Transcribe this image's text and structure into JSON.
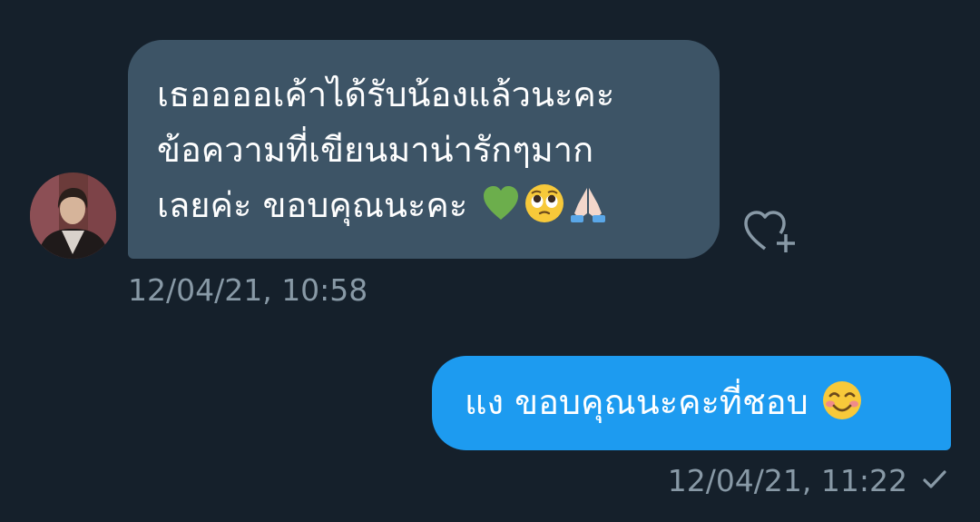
{
  "conversation": {
    "incoming": {
      "lines": [
        "เธออออเค้าได้รับน้องแล้วนะคะ",
        "ข้อความที่เขียนมาน่ารักๆมาก",
        "เลยค่ะ ขอบคุณนะคะ"
      ],
      "emoji": [
        "green-heart",
        "pleading-face",
        "folded-hands"
      ],
      "timestamp": "12/04/21, 10:58"
    },
    "outgoing": {
      "text": "แง ขอบคุณนะคะที่ชอบ",
      "emoji": [
        "smiling-face-with-smiling-eyes"
      ],
      "timestamp": "12/04/21, 11:22",
      "status_icon": "checkmark-icon"
    }
  },
  "colors": {
    "background": "#15202b",
    "incoming_bubble": "#3d5466",
    "outgoing_bubble": "#1d9bf0",
    "timestamp": "#8899a6"
  }
}
